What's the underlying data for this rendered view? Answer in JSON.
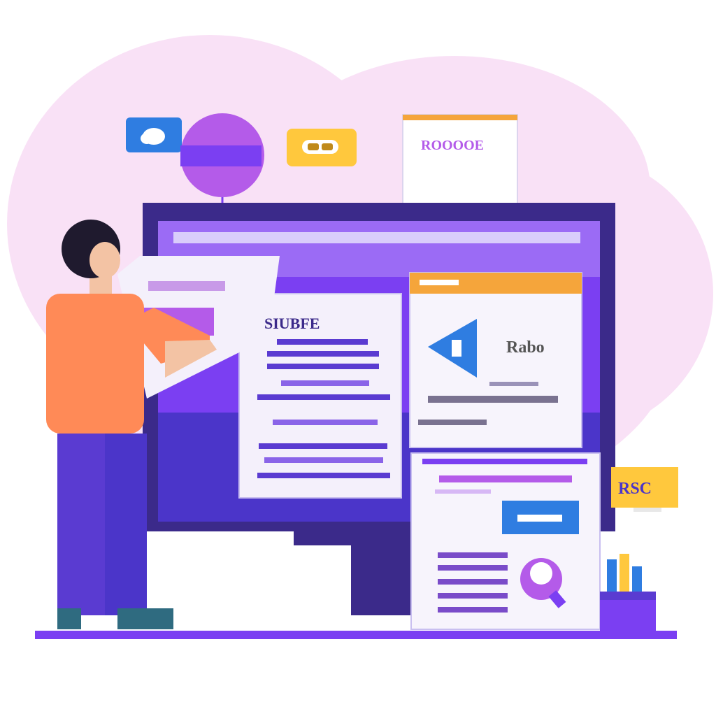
{
  "labels": {
    "sticky_card": "ROOOOE",
    "panel_left_heading": "SIUBFE",
    "panel_right_heading": "Rabo",
    "badge": "RSC"
  },
  "colors": {
    "purple": "#7b3ff2",
    "deep_purple": "#3b2a8a",
    "orange": "#ff8a57",
    "accent_orange": "#f5a53b",
    "yellow": "#ffc83d",
    "blue": "#2f7de1",
    "pink_bg": "#f9e1f6",
    "violet": "#b45be9"
  },
  "icons": [
    "cloud-icon",
    "play-icon",
    "search-icon",
    "toggle-icon"
  ]
}
